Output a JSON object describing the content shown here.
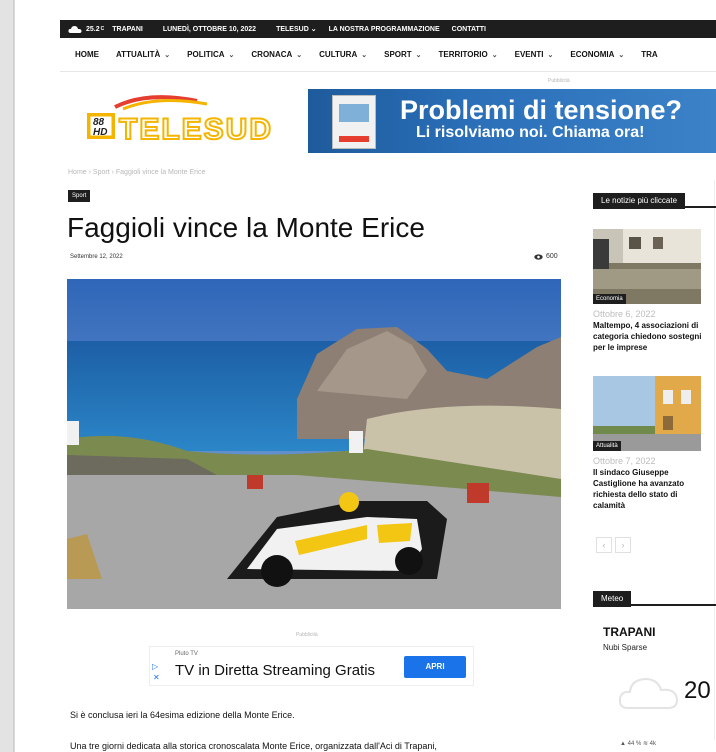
{
  "topbar": {
    "temperature": "25.2",
    "temp_unit": "C",
    "city": "TRAPANI",
    "date": "LUNEDÌ, OTTOBRE 10, 2022",
    "links": [
      "TELESUD",
      "LA NOSTRA PROGRAMMAZIONE",
      "CONTATTI"
    ]
  },
  "nav": {
    "items": [
      {
        "label": "HOME",
        "dropdown": false
      },
      {
        "label": "ATTUALITÀ",
        "dropdown": true
      },
      {
        "label": "POLITICA",
        "dropdown": true
      },
      {
        "label": "CRONACA",
        "dropdown": true
      },
      {
        "label": "CULTURA",
        "dropdown": true
      },
      {
        "label": "SPORT",
        "dropdown": true
      },
      {
        "label": "TERRITORIO",
        "dropdown": true
      },
      {
        "label": "EVENTI",
        "dropdown": true
      },
      {
        "label": "ECONOMIA",
        "dropdown": true
      },
      {
        "label": "TRA",
        "dropdown": false
      }
    ]
  },
  "ad_label": "Pubblicità",
  "logo": {
    "badge_top": "88",
    "badge_bottom": "HD",
    "text": "TELESUD"
  },
  "banner": {
    "line1": "Problemi di tensione?",
    "line2": "Li risolviamo noi. Chiama ora!"
  },
  "breadcrumb": [
    "Home",
    "Sport",
    "Faggioli vince la Monte Erice"
  ],
  "article": {
    "category": "Sport",
    "title": "Faggioli vince la Monte Erice",
    "date": "Settembre 12, 2022",
    "views": "600",
    "paragraph1": "Si è conclusa ieri la 64esima edizione della Monte Erice.",
    "paragraph2": "Una tre giorni dedicata alla storica cronoscalata Monte Erice, organizzata dall'Aci di Trapani,"
  },
  "ad": {
    "source": "Pluto TV",
    "headline": "TV in Diretta Streaming Gratis",
    "cta": "APRI"
  },
  "sidebar": {
    "popular_title": "Le notizie più cliccate",
    "news": [
      {
        "category": "Economia",
        "date": "Ottobre 6, 2022",
        "title": "Maltempo, 4 associazioni di categoria chiedono sostegni per le imprese"
      },
      {
        "category": "Attualità",
        "date": "Ottobre 7, 2022",
        "title": "Il sindaco Giuseppe Castiglione ha avanzato richiesta dello stato di calamità"
      }
    ],
    "pager": [
      "‹",
      "›"
    ],
    "meteo_title": "Meteo",
    "city": "TRAPANI",
    "condition": "Nubi Sparse",
    "temperature": "20",
    "wind": "▲ 44 %   ≋ 4k"
  },
  "colors": {
    "topbar": "#1e1e1e",
    "accent": "#1e1e1e",
    "banner": "#2a6fb8",
    "cta": "#1a73e8"
  }
}
